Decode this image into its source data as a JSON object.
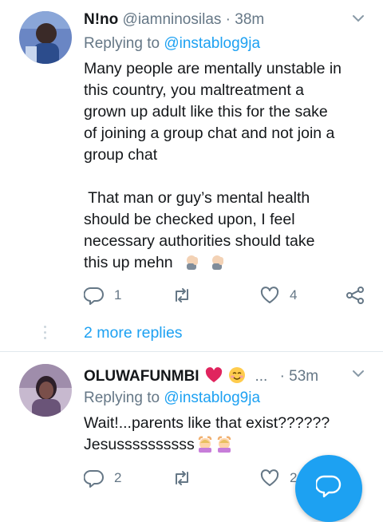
{
  "tweets": [
    {
      "name": "N!no",
      "handle": "@iamninosilas",
      "dot": "·",
      "time": "38m",
      "replying_prefix": "Replying to ",
      "replying_to": "@instablog9ja",
      "body_lines": [
        "Many people are mentally unstable in",
        "this country, you maltreatment a",
        "grown up adult like this for the sake",
        "of joining a group chat and not join a",
        "group chat",
        "",
        " That man or guy’s mental health",
        "should be checked upon, I feel",
        "necessary authorities should take",
        "this up mehn"
      ],
      "reply_count": "1",
      "retweet_count": "",
      "like_count": "4",
      "more_replies": "2 more replies"
    },
    {
      "name": "OLUWAFUNMBI",
      "ellipsis": "...",
      "dot": "·",
      "time": "53m",
      "replying_prefix": "Replying to ",
      "replying_to": "@instablog9ja",
      "body_lines": [
        "Wait!...parents like that exist??????",
        "Jesussssssssss"
      ],
      "reply_count": "2",
      "like_count": "2"
    }
  ],
  "colors": {
    "accent": "#1da1f2",
    "secondary_text": "#657786",
    "heart_emoji": "#e0245e"
  },
  "icons": {
    "reply": "reply-icon",
    "retweet": "retweet-icon",
    "like": "heart-icon",
    "share": "share-icon",
    "chevron": "chevron-down-icon",
    "compose": "compose-icon"
  }
}
